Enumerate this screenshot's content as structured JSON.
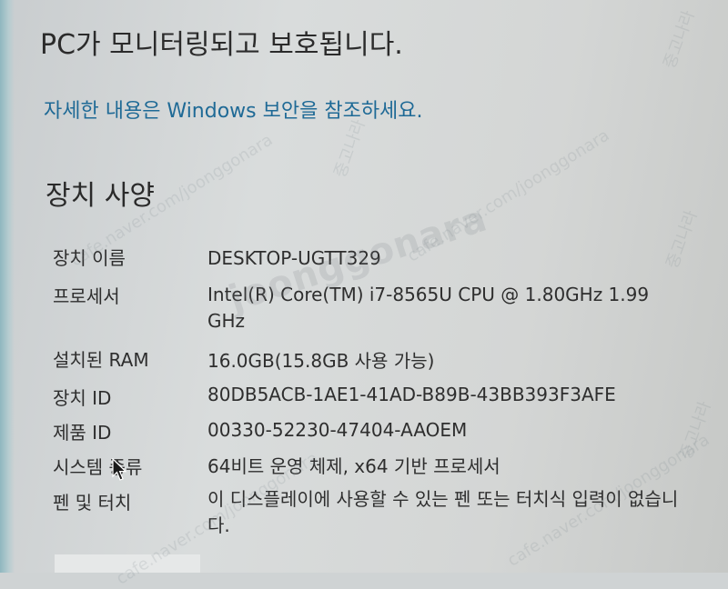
{
  "header": {
    "protect_title": "PC가 모니터링되고 보호됩니다.",
    "security_link": "자세한 내용은 Windows 보안을 참조하세요."
  },
  "device_specs": {
    "title": "장치 사양",
    "device_name": {
      "label": "장치 이름",
      "value": "DESKTOP-UGTT329"
    },
    "processor": {
      "label": "프로세서",
      "value": "Intel(R) Core(TM) i7-8565U CPU @ 1.80GHz   1.99 GHz"
    },
    "ram": {
      "label": "설치된 RAM",
      "value": "16.0GB(15.8GB 사용 가능)"
    },
    "device_id": {
      "label": "장치 ID",
      "value": "80DB5ACB-1AE1-41AD-B89B-43BB393F3AFE"
    },
    "product_id": {
      "label": "제품 ID",
      "value": "00330-52230-47404-AAOEM"
    },
    "system_type": {
      "label": "시스템 종류",
      "value": "64비트 운영 체제, x64 기반 프로세서"
    },
    "pen_touch": {
      "label": "펜 및 터치",
      "value": "이 디스플레이에 사용할 수 있는 펜 또는 터치식 입력이 없습니다."
    }
  },
  "watermark": {
    "brand": "joonggonara",
    "site": "cafe.naver.com/joonggonara",
    "tag": "중고나라"
  },
  "icons": {
    "cursor": "mouse-pointer-icon"
  }
}
